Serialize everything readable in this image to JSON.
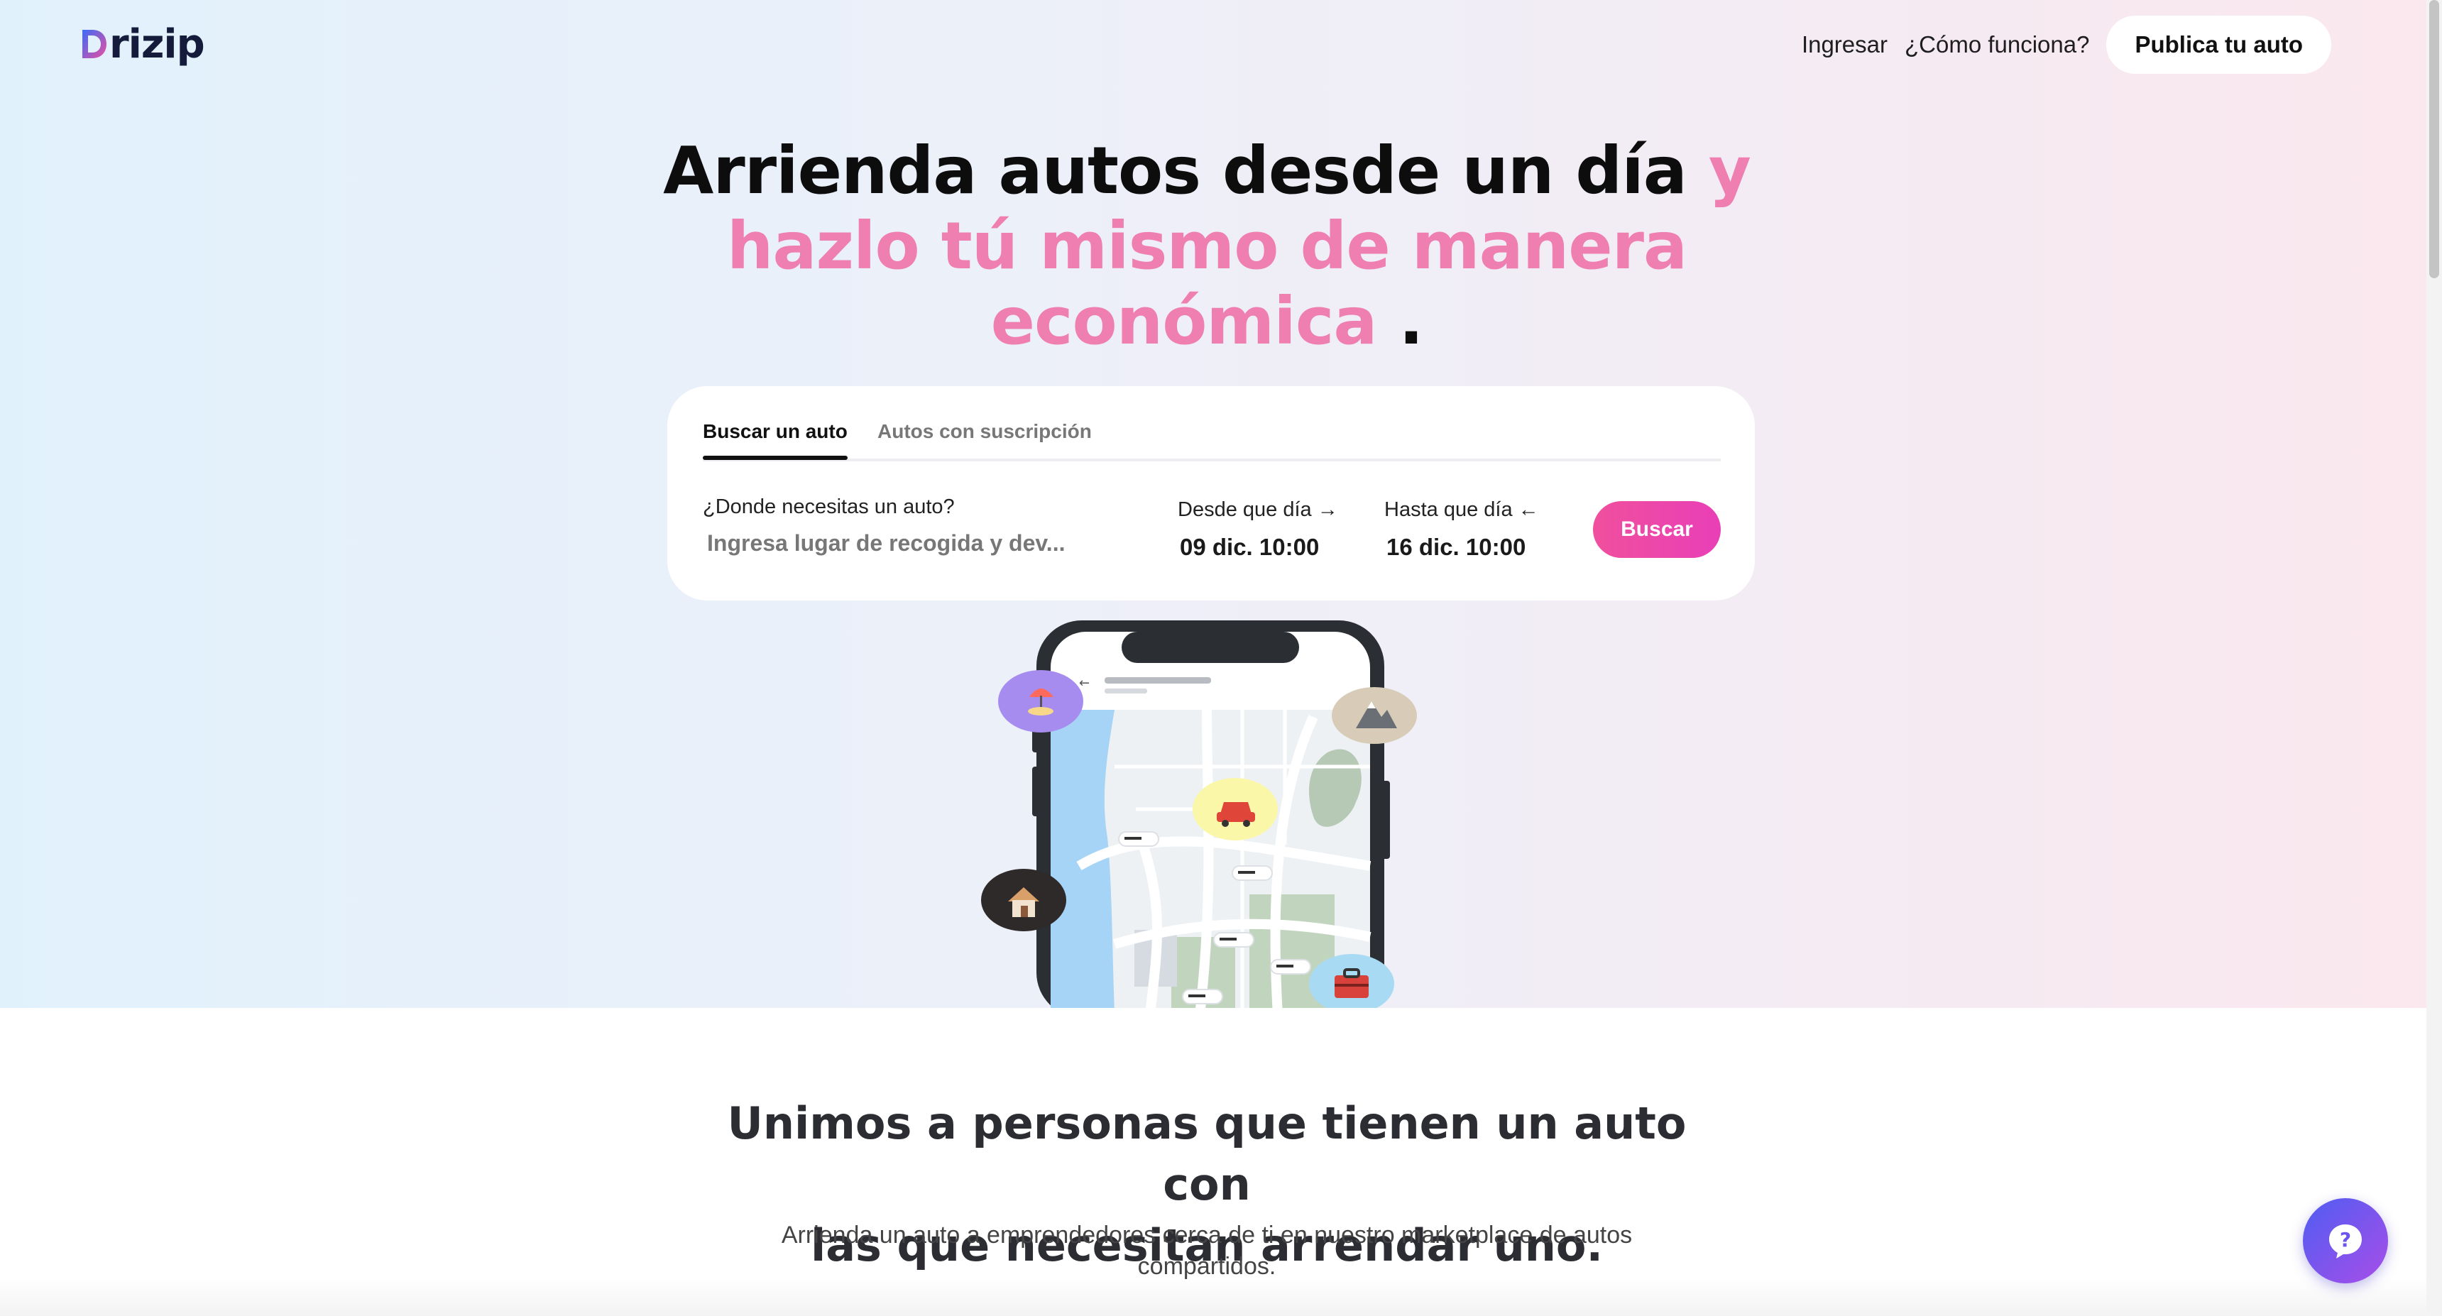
{
  "brand": {
    "name": "rizip",
    "logo_icon": "drizip-logo-icon"
  },
  "nav": {
    "login": "Ingresar",
    "how": "¿Cómo funciona?",
    "publish": "Publica tu auto"
  },
  "hero": {
    "title_dark": "Arrienda autos desde un día",
    "title_pink_1": "y",
    "title_pink_2": "hazlo tú mismo de manera",
    "title_pink_3": "económica",
    "title_dot": "."
  },
  "search": {
    "tabs": [
      "Buscar un auto",
      "Autos con suscripción"
    ],
    "where_label": "¿Donde necesitas un auto?",
    "where_placeholder": "Ingresa lugar de recogida y dev...",
    "from_label": "Desde que día →",
    "from_value": "09 dic. 10:00",
    "to_label": "Hasta que día ←",
    "to_value": "16 dic. 10:00",
    "button": "Buscar"
  },
  "illustration": {
    "pins": [
      "beach-icon",
      "mountain-icon",
      "car-icon",
      "house-icon",
      "toolbox-icon"
    ]
  },
  "section2": {
    "title_line1": "Unimos a personas que tienen un auto con",
    "title_line2": "las que necesitan arrendar uno.",
    "subtitle": "Arrienda un auto a emprendedores cerca de ti en nuestro marketplace de autos compartidos."
  },
  "help": {
    "icon": "question-icon"
  },
  "colors": {
    "accent_pink": "#ee7fb0",
    "button_pink": "#f04f9d",
    "help_purple": "#6a55ee"
  }
}
